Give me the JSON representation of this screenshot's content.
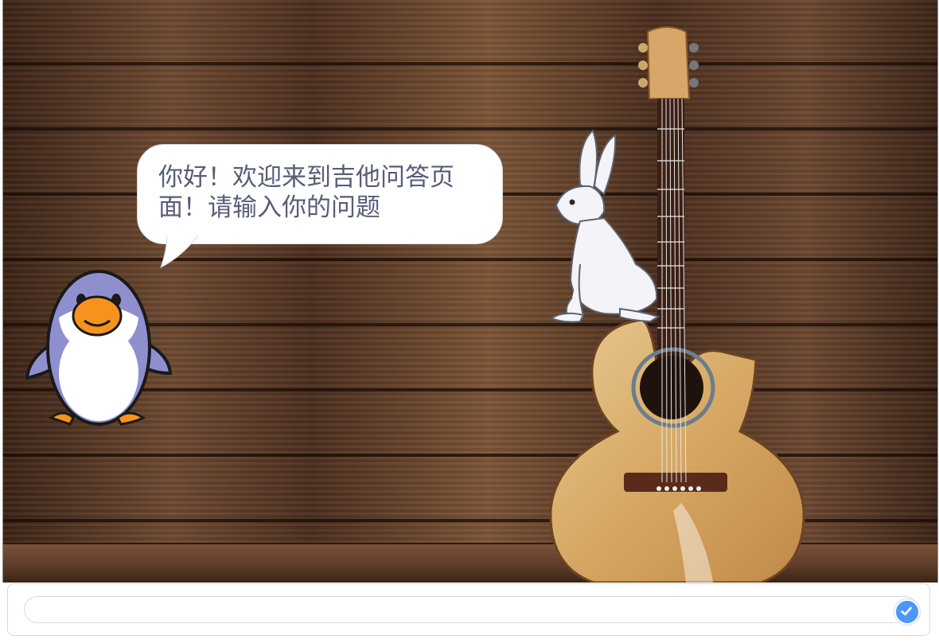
{
  "stage": {
    "backdrop": "wood-plank-wall-with-acoustic-guitar",
    "speech_bubble": {
      "text": "你好！欢迎来到吉他问答页面！请输入你的问题"
    },
    "sprites": [
      {
        "name": "penguin",
        "icon": "penguin-icon"
      },
      {
        "name": "rabbit",
        "icon": "rabbit-icon"
      },
      {
        "name": "guitar",
        "icon": "guitar-icon"
      }
    ]
  },
  "answer_prompt": {
    "value": "",
    "placeholder": "",
    "submit_icon": "check-icon"
  },
  "colors": {
    "bubble_text": "#575e75",
    "submit_button": "#4c97ff",
    "input_border": "#d9d9d9"
  }
}
